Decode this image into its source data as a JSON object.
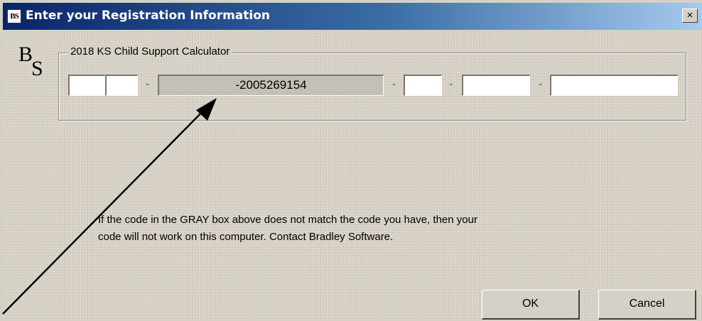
{
  "window": {
    "title": "Enter your Registration Information",
    "icon_text": "BS",
    "close_glyph": "×"
  },
  "logo": {
    "text": "BS"
  },
  "group": {
    "label": "2018 KS Child Support Calculator",
    "machine_code": "-2005269154",
    "separator": "-",
    "fields": [
      "",
      "",
      "",
      "",
      "",
      ""
    ]
  },
  "message": {
    "line1": "If the code in the GRAY box above does not match the code you have, then your",
    "line2": "code will not work on this computer.  Contact Bradley Software."
  },
  "buttons": {
    "ok": "OK",
    "cancel": "Cancel"
  },
  "colors": {
    "title_start": "#0a246a",
    "title_end": "#a6caf0",
    "dialog_bg": "#d8d2c7",
    "gray_box": "#c4c0b8",
    "arrow": "#000000"
  },
  "icons": [
    "bs-logo-icon",
    "close-icon",
    "annotation-arrow"
  ]
}
